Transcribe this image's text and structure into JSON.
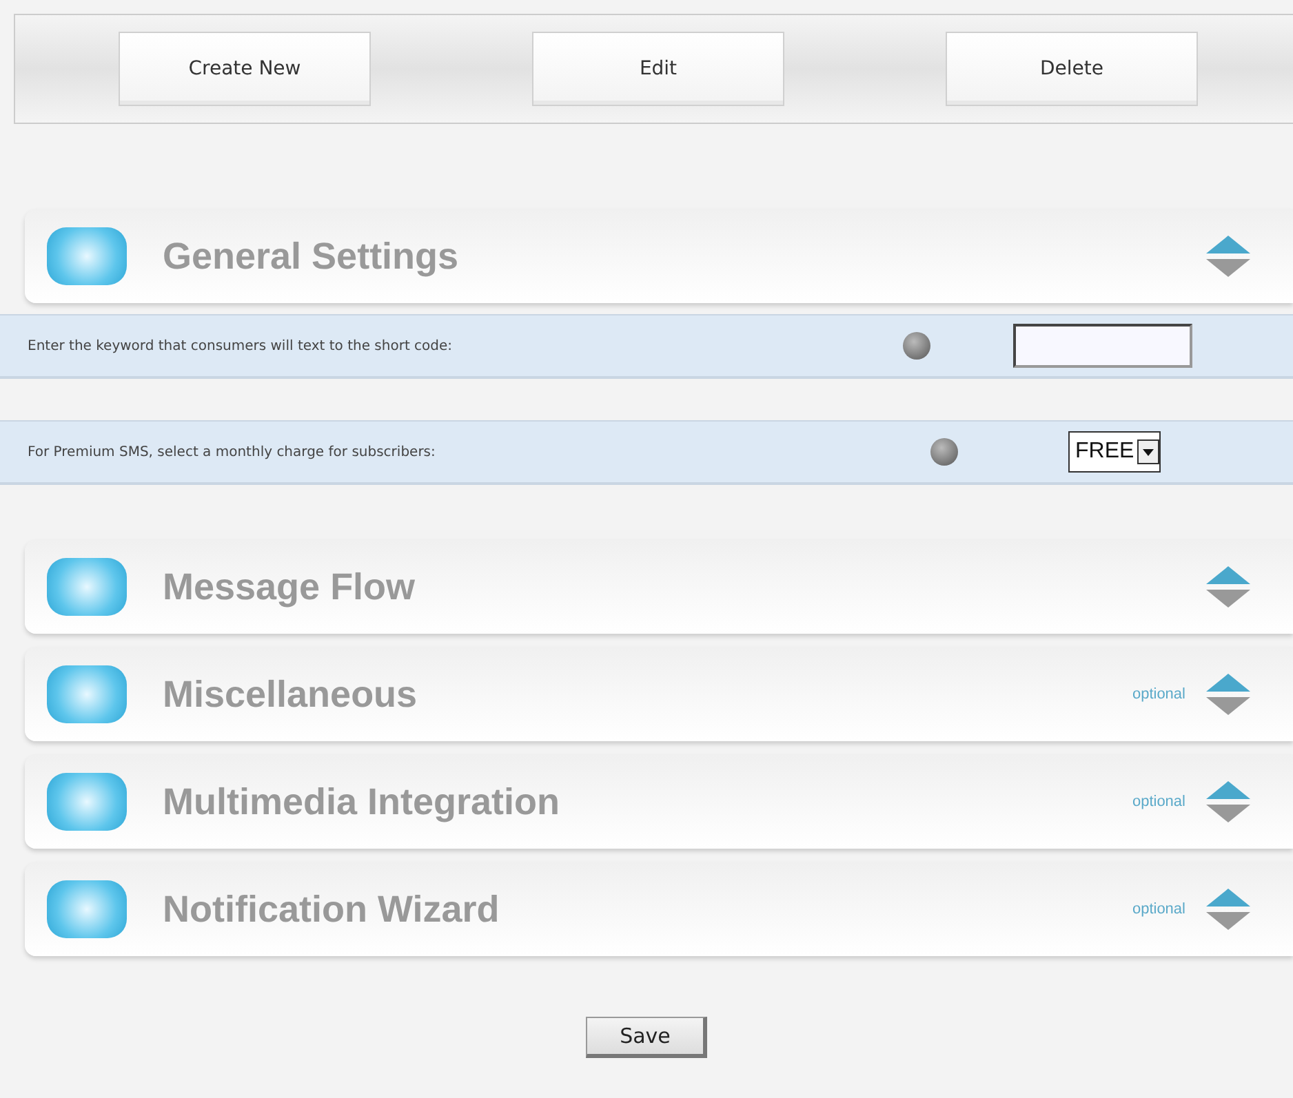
{
  "toolbar": {
    "buttons": [
      "Create New",
      "Edit",
      "Delete"
    ]
  },
  "sections": [
    {
      "title": "General Settings",
      "fields": [
        {
          "kind": "text",
          "label": "Enter the keyword that consumers will text to the short code:"
        },
        {
          "kind": "select",
          "label": "For Premium SMS, select a monthly charge for subscribers:",
          "value": "FREE"
        }
      ]
    },
    {
      "title": "Message Flow"
    },
    {
      "title": "Miscellaneous",
      "badge": "optional"
    },
    {
      "title": "Multimedia Integration",
      "badge": "optional"
    },
    {
      "title": "Notification Wizard",
      "badge": "optional"
    }
  ],
  "save_button": "Save"
}
